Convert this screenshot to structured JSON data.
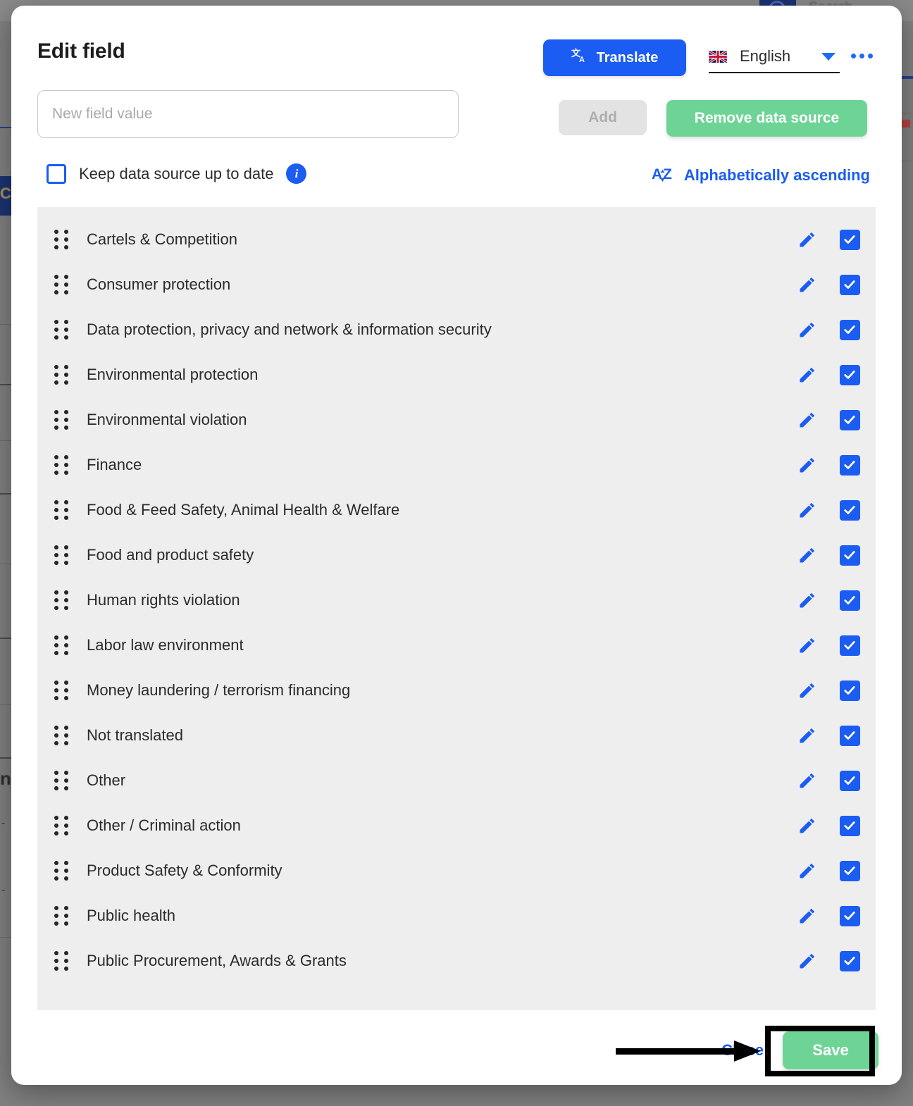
{
  "background": {
    "search_placeholder": "Search",
    "left_chip_text": "CF",
    "n_glyph": "n",
    "dash": "- -"
  },
  "modal": {
    "title": "Edit field",
    "header": {
      "translate_label": "Translate",
      "translate_icon": "translate-icon",
      "language": {
        "flag": "uk-flag-icon",
        "value": "English",
        "caret_icon": "chevron-down-icon"
      },
      "more_icon": "kebab-menu-icon"
    },
    "form": {
      "new_value_placeholder": "New field value",
      "new_value": "",
      "add_label": "Add",
      "remove_label": "Remove data source"
    },
    "options": {
      "keep_label": "Keep data source up to date",
      "keep_checked": false,
      "info_icon": "info-icon",
      "info_glyph": "i",
      "sort_label": "Alphabetically ascending",
      "sort_icon": "sort-az-icon"
    },
    "list": {
      "row_edit_icon": "pencil-icon",
      "row_check_icon": "checkbox-checked-icon",
      "row_drag_icon": "drag-handle-icon",
      "items": [
        {
          "label": "Cartels & Competition",
          "checked": true
        },
        {
          "label": "Consumer protection",
          "checked": true
        },
        {
          "label": "Data protection, privacy and network & information security",
          "checked": true
        },
        {
          "label": "Environmental protection",
          "checked": true
        },
        {
          "label": "Environmental violation",
          "checked": true
        },
        {
          "label": "Finance",
          "checked": true
        },
        {
          "label": "Food & Feed Safety, Animal Health & Welfare",
          "checked": true
        },
        {
          "label": "Food and product safety",
          "checked": true
        },
        {
          "label": "Human rights violation",
          "checked": true
        },
        {
          "label": "Labor law environment",
          "checked": true
        },
        {
          "label": "Money laundering / terrorism financing",
          "checked": true
        },
        {
          "label": "Not translated",
          "checked": true
        },
        {
          "label": "Other",
          "checked": true
        },
        {
          "label": "Other / Criminal action",
          "checked": true
        },
        {
          "label": "Product Safety & Conformity",
          "checked": true
        },
        {
          "label": "Public health",
          "checked": true
        },
        {
          "label": "Public Procurement, Awards & Grants",
          "checked": true
        }
      ]
    },
    "footer": {
      "close_label": "Close",
      "save_label": "Save"
    }
  },
  "annotations": {
    "arrow_target": "save-button",
    "highlight_target": "save-button"
  },
  "colors": {
    "primary_blue": "#1b5cf3",
    "green": "#6ed496",
    "list_bg": "#eeeeee",
    "disabled_grey": "#e3e3e3",
    "text": "#2b2b2b",
    "annotation": "#000000"
  }
}
